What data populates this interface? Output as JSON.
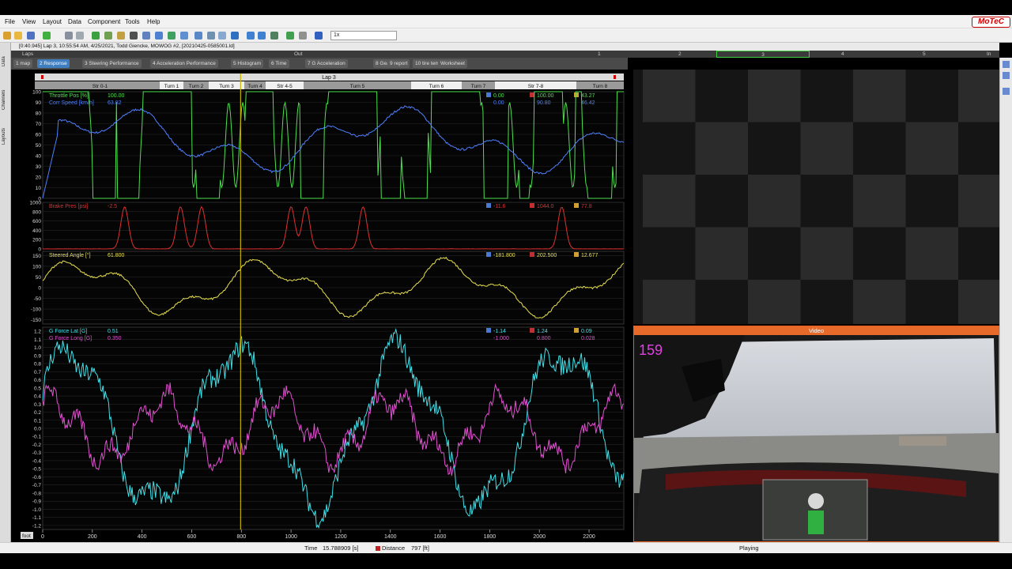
{
  "app": {
    "logo": "MoTeC",
    "window_title": "[0:40.945] Lap 3, 10:55:54 AM, 4/25/2021, Todd Giencke, MOWOG #2, [20210425-0585001.ld]"
  },
  "menu": [
    "File",
    "View",
    "Layout",
    "Data",
    "Component",
    "Tools",
    "Help"
  ],
  "toolbar": {
    "zoom_value": "1x"
  },
  "sidebar_left": {
    "labels": [
      "Data",
      "Channels",
      "Layouts"
    ]
  },
  "laps_bar": {
    "label": "Laps",
    "out": "Out",
    "laps": [
      "1",
      "2",
      "3",
      "4",
      "5"
    ],
    "in": "In"
  },
  "tabs": [
    {
      "num": "1",
      "label": "map"
    },
    {
      "num": "2",
      "label": "Response"
    },
    {
      "num": "3",
      "label": "Steering Performance"
    },
    {
      "num": "4",
      "label": "Acceleration Performance"
    },
    {
      "num": "5",
      "label": "Histogram"
    },
    {
      "num": "6",
      "label": "Time"
    },
    {
      "num": "7",
      "label": "G Acceleration"
    },
    {
      "num": "8",
      "label": "Gear"
    },
    {
      "num": "9",
      "label": "report"
    },
    {
      "num": "10",
      "label": "tire temp"
    },
    {
      "num": "",
      "label": "Worksheet"
    }
  ],
  "lap_header": "Lap 3",
  "sections": [
    "Str 0-1",
    "Turn 1",
    "Turn 2",
    "Turn 3",
    "Turn 4",
    "Str 4-5",
    "Turn 5",
    "Turn 6",
    "Turn 7",
    "Str 7-8",
    "Turn 8"
  ],
  "panes": [
    {
      "channels": [
        {
          "name": "Throttle Pos [%]",
          "cursor": "100.00",
          "min": "0.00",
          "max": "100.00",
          "avg": "43.27",
          "color": "#4ee04e"
        },
        {
          "name": "Corr Speed [km/h]",
          "cursor": "63.82",
          "min": "0.00",
          "max": "90.80",
          "avg": "46.42",
          "color": "#5080ff"
        }
      ],
      "y_ticks": [
        "100",
        "90",
        "80",
        "70",
        "60",
        "50",
        "40",
        "30",
        "20",
        "10",
        "0"
      ]
    },
    {
      "channels": [
        {
          "name": "Brake Pres [psi]",
          "cursor": "-2.5",
          "min": "-11.6",
          "max": "1044.0",
          "avg": "77.8",
          "color": "#e03030"
        }
      ],
      "y_ticks": [
        "1000",
        "800",
        "600",
        "400",
        "200",
        "0"
      ]
    },
    {
      "channels": [
        {
          "name": "Steered Angle [°]",
          "cursor": "61.800",
          "min": "-181.800",
          "max": "202.500",
          "avg": "12.677",
          "color": "#e8e050"
        }
      ],
      "y_ticks": [
        "150",
        "100",
        "50",
        "0",
        "-50",
        "-100",
        "-150"
      ]
    },
    {
      "channels": [
        {
          "name": "G Force Lat [G]",
          "cursor": "0.51",
          "min": "-1.14",
          "max": "1.24",
          "avg": "0.09",
          "color": "#40e0e8"
        },
        {
          "name": "G Force Long [G]",
          "cursor": "0.350",
          "min": "-1.000",
          "max": "0.800",
          "avg": "0.028",
          "color": "#e050d0"
        }
      ],
      "y_ticks": [
        "1.2",
        "1.1",
        "1.0",
        "0.9",
        "0.8",
        "0.7",
        "0.6",
        "0.5",
        "0.4",
        "0.3",
        "0.2",
        "0.1",
        "0.0",
        "-0.1",
        "-0.2",
        "-0.3",
        "-0.4",
        "-0.5",
        "-0.6",
        "-0.7",
        "-0.8",
        "-0.9",
        "-1.0",
        "-1.1",
        "-1.2"
      ]
    }
  ],
  "x_axis": {
    "unit": "foot",
    "ticks": [
      "0",
      "200",
      "400",
      "600",
      "800",
      "1000",
      "1200",
      "1400",
      "1600",
      "1800",
      "2000",
      "2200"
    ]
  },
  "video": {
    "title": "Video",
    "overlay_number": "159"
  },
  "status": {
    "time_label": "Time",
    "time_value": "15.788909 [s]",
    "dist_label": "Distance",
    "dist_value": "797 [ft]",
    "state": "Playing"
  },
  "colors": {
    "accent_tab": "#3f7fbf",
    "video_header": "#e86a2a",
    "cursor_line": "#c8b400"
  }
}
